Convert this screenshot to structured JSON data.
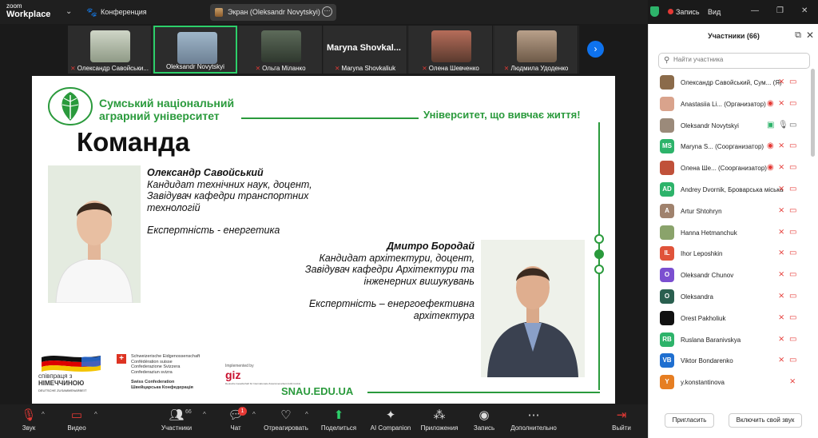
{
  "app": {
    "logo_small": "zoom",
    "logo_big": "Workplace"
  },
  "meeting": {
    "title": "Конференция"
  },
  "share": {
    "label": "Экран (Oleksandr Novytskyi)"
  },
  "status": {
    "recording": "Запись",
    "view": "Вид"
  },
  "strip": {
    "tiles": [
      {
        "name": "Олександр Савойськи..."
      },
      {
        "name": "Oleksandr Novytskyi"
      },
      {
        "name": "Ольга Міланко"
      },
      {
        "name": "Maryna Shovkaliuk",
        "big": "Maryna  Shovkal..."
      },
      {
        "name": "Олена Шевченко"
      },
      {
        "name": "Людмила Удоденко"
      }
    ]
  },
  "slide": {
    "university": [
      "Сумський національний",
      "аграрний університет"
    ],
    "motto": "Університет, що вивчає життя!",
    "title": "Команда",
    "person1": {
      "name": "Олександр Савойський",
      "lines": [
        "Кандидат технічних наук, доцент,",
        "Завідувач кафедри транспортних",
        "технологій"
      ],
      "expertise": "Експертність - енергетика"
    },
    "person2": {
      "name": "Дмитро Бородай",
      "lines": [
        "Кандидат архітектури, доцент,",
        "Завідувач кафедри Архітектури та",
        "інженерних вишукувань"
      ],
      "expertise": [
        "Експертність – енергоефективна",
        "архітектура"
      ]
    },
    "website": "SNAU.EDU.UA",
    "partner_de": [
      "співпраця з",
      "НІМЕЧЧИНОЮ",
      "DEUTSCHE ZUSAMMENARBEIT"
    ],
    "partner_ch": [
      "Schweizerische Eidgenossenschaft",
      "Confédération suisse",
      "Confederazione Svizzera",
      "Confederaziun svizra"
    ],
    "partner_ch_2": [
      "Swiss Confederation",
      "Швейцарська Конфедерація"
    ],
    "partner_giz": {
      "small": "Implemented by",
      "big": "giz",
      "sub": "Deutsche Gesellschaft für Internationale Zusammenarbeit (GIZ) GmbH"
    }
  },
  "toolbar": {
    "audio": "Звук",
    "video": "Видео",
    "participants": "Участники",
    "participants_count": "66",
    "chat": "Чат",
    "chat_badge": "1",
    "reactions": "Отреагировать",
    "share": "Поделиться",
    "ai": "AI Companion",
    "apps": "Приложения",
    "record": "Запись",
    "more": "Дополнительно",
    "leave": "Выйти"
  },
  "panel": {
    "title": "Участники (66)",
    "search_placeholder": "Найти участника",
    "participants": [
      {
        "name": "Олександр Савойський, Сум... (Я)",
        "avatar": "",
        "color": "#8b6b4a"
      },
      {
        "name": "Anastasiia Li... (Организатор)",
        "avatar": "",
        "color": "#d9a38c"
      },
      {
        "name": "Oleksandr Novytskyi",
        "avatar": "",
        "color": "#9b8a7a"
      },
      {
        "name": "Maryna S... (Соорганизатор)",
        "avatar": "MS",
        "color": "#2db36a"
      },
      {
        "name": "Олена Ше... (Соорганизатор)",
        "avatar": "",
        "color": "#c0513a"
      },
      {
        "name": "Andrey Dvornik, Броварська міська ...",
        "avatar": "AD",
        "color": "#2db36a"
      },
      {
        "name": "Artur Shtohryn",
        "avatar": "A",
        "color": "#a0826d"
      },
      {
        "name": "Hanna Hetmanchuk",
        "avatar": "",
        "color": "#8aa36b"
      },
      {
        "name": "Ihor Leposhkin",
        "avatar": "IL",
        "color": "#e0533a"
      },
      {
        "name": "Oleksandr Chunov",
        "avatar": "O",
        "color": "#7b4fd0"
      },
      {
        "name": "Oleksandra",
        "avatar": "O",
        "color": "#2a5f4f"
      },
      {
        "name": "Orest Pakholiuk",
        "avatar": "",
        "color": "#111111"
      },
      {
        "name": "Ruslana Baranivskya",
        "avatar": "RB",
        "color": "#2db36a"
      },
      {
        "name": "Viktor Bondarenko",
        "avatar": "VB",
        "color": "#1f6fd0"
      },
      {
        "name": "y.konstantinova",
        "avatar": "Y",
        "color": "#e67e22"
      }
    ],
    "invite": "Пригласить",
    "unmute": "Включить свой звук"
  }
}
